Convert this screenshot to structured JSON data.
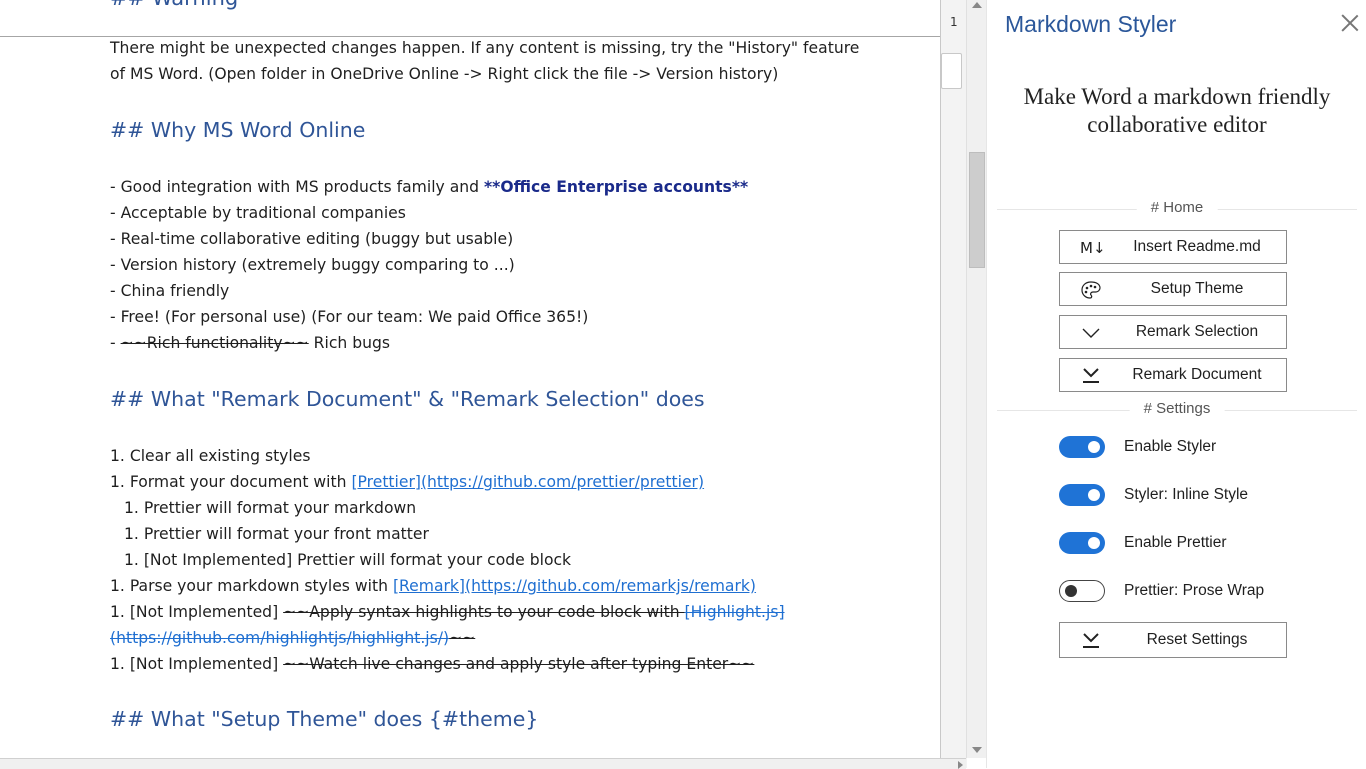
{
  "document": {
    "cut_heading": "## Warning",
    "paragraphs": [
      "There might be unexpected changes happen. If any content is missing, try the \"History\" feature",
      "of MS Word. (Open folder in OneDrive Online -> Right click the file -> Version history)"
    ],
    "h_why": "## Why MS Word Online",
    "why_items": {
      "b1_prefix": "- Good integration with MS products family and ",
      "b1_bold": "**Office Enterprise accounts**",
      "b2": "- Acceptable by traditional companies",
      "b3": "- Real-time collaborative editing (buggy but usable)",
      "b4": "- Version history (extremely buggy comparing to ...)",
      "b5": "- China friendly",
      "b6": "- Free! (For personal use) (For our team: We paid Office 365!)",
      "b7_prefix": "- ",
      "b7_strike": "~~Rich functionality~~",
      "b7_suffix": " Rich bugs"
    },
    "h_what_remark": "## What \"Remark Document\" & \"Remark Selection\" does",
    "remark_items": {
      "l1": "1. Clear all existing styles",
      "l2_prefix": "1. Format your document with ",
      "l2_link": "[Prettier](https://github.com/prettier/prettier)",
      "l3": "1. Prettier will format your markdown",
      "l4": "1. Prettier will format your front matter",
      "l5": "1. [Not Implemented] Prettier will format your code block",
      "l6_prefix": "1. Parse your markdown styles with ",
      "l6_link": "[Remark](https://github.com/remarkjs/remark)",
      "l7_prefix": "1. [Not Implemented] ",
      "l7_strike": "~~Apply syntax highlights to your code block with ",
      "l7_link": "[Highlight.js]",
      "l8_link": "(https://github.com/highlightjs/highlight.js/)",
      "l8_strike": "~~",
      "l9_prefix": "1. [Not Implemented] ",
      "l9_strike": "~~Watch live changes and apply style after typing Enter~~"
    },
    "h_theme": "## What \"Setup Theme\" does {#theme}"
  },
  "ruler": {
    "page_number": "1"
  },
  "panel": {
    "title": "Markdown Styler",
    "tagline_line1": "Make Word a markdown friendly",
    "tagline_line2": "collaborative editor",
    "home_section": "# Home",
    "settings_section": "# Settings",
    "buttons": {
      "insert_readme": "Insert Readme.md",
      "setup_theme": "Setup Theme",
      "remark_selection": "Remark Selection",
      "remark_document": "Remark Document",
      "reset_settings": "Reset Settings"
    },
    "insert_icon_text": "M↓",
    "toggles": [
      {
        "label": "Enable Styler",
        "on": true
      },
      {
        "label": "Styler: Inline Style",
        "on": true
      },
      {
        "label": "Enable Prettier",
        "on": true
      },
      {
        "label": "Prettier: Prose Wrap",
        "on": false
      }
    ],
    "accent_color": "#1f73d6",
    "title_color": "#2b579a"
  }
}
